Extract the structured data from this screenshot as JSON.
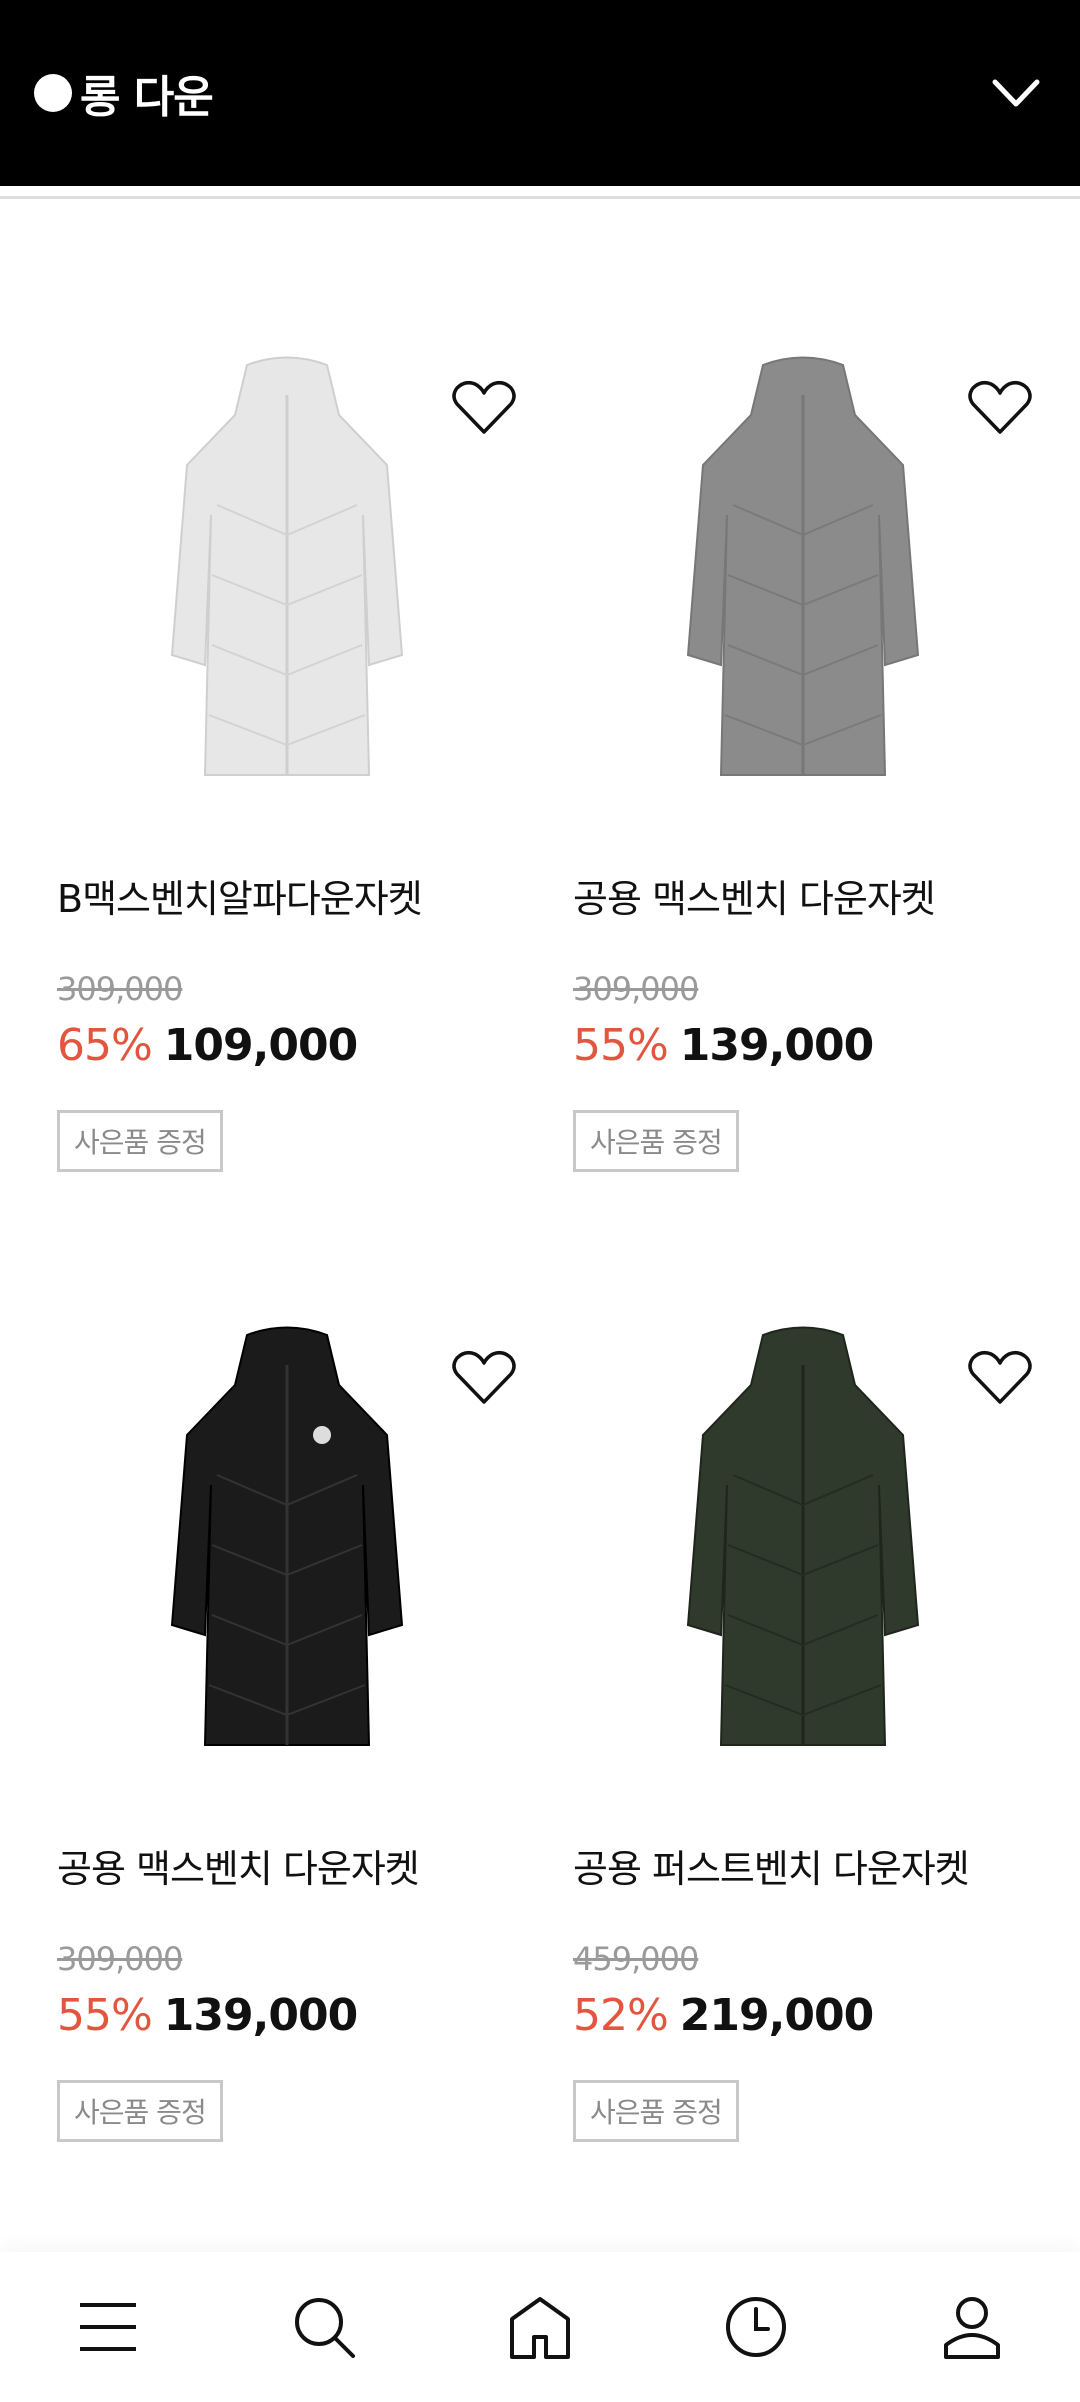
{
  "header": {
    "title": "롱 다운"
  },
  "products": [
    {
      "name": "B맥스벤치알파다운자켓",
      "original_price": "309,000",
      "discount": "65%",
      "price": "109,000",
      "tag": "사은품 증정",
      "color": "#e7e7e7"
    },
    {
      "name": "공용 맥스벤치 다운자켓",
      "original_price": "309,000",
      "discount": "55%",
      "price": "139,000",
      "tag": "사은품 증정",
      "color": "#8b8b8b"
    },
    {
      "name": "공용 맥스벤치 다운자켓",
      "original_price": "309,000",
      "discount": "55%",
      "price": "139,000",
      "tag": "사은품 증정",
      "color": "#1b1b1b"
    },
    {
      "name": "공용 퍼스트벤치 다운자켓",
      "original_price": "459,000",
      "discount": "52%",
      "price": "219,000",
      "tag": "사은품 증정",
      "color": "#2f3a2c"
    }
  ],
  "bottom_nav": [
    {
      "icon": "menu-icon"
    },
    {
      "icon": "search-icon"
    },
    {
      "icon": "home-icon"
    },
    {
      "icon": "history-icon"
    },
    {
      "icon": "profile-icon"
    }
  ],
  "colors": {
    "header_bg": "#000000",
    "discount": "#e2553e"
  }
}
